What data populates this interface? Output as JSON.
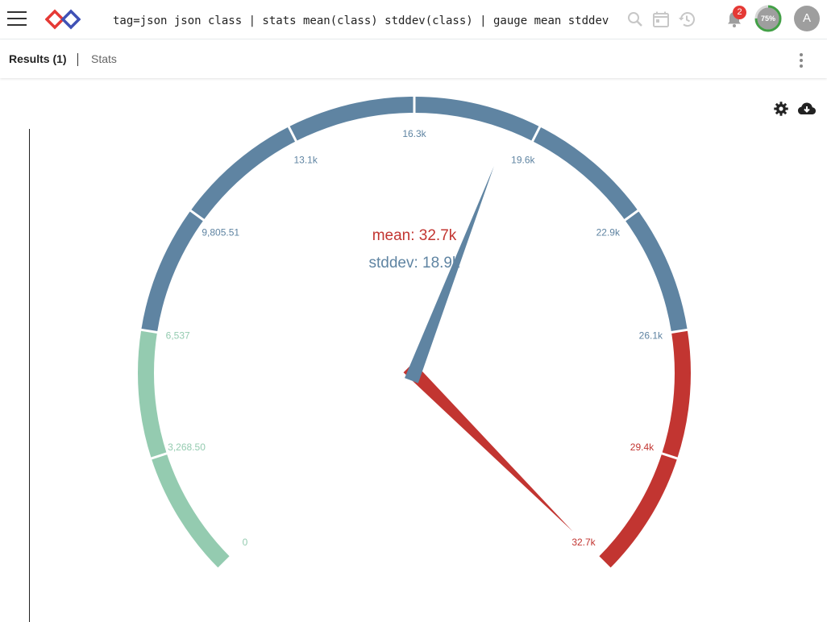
{
  "header": {
    "query": "tag=json json class | stats mean(class) stddev(class) | gauge mean stddev",
    "notification_count": "2",
    "progress_label": "75%",
    "progress_value": 0.75,
    "avatar_initial": "A"
  },
  "tabs": {
    "results_label": "Results (1)",
    "stats_label": "Stats"
  },
  "colors": {
    "green": "#94cbb0",
    "blue": "#5f84a2",
    "red": "#c23531",
    "progress": "#43a047"
  },
  "chart_data": {
    "type": "gauge",
    "min": 0,
    "max": 32700,
    "tick_labels": [
      "0",
      "3,268.50",
      "6,537",
      "9,805.51",
      "13.1k",
      "16.3k",
      "19.6k",
      "22.9k",
      "26.1k",
      "29.4k",
      "32.7k"
    ],
    "bands": [
      {
        "from": 0,
        "to": 0.2,
        "color": "#94cbb0"
      },
      {
        "from": 0.2,
        "to": 0.8,
        "color": "#5f84a2"
      },
      {
        "from": 0.8,
        "to": 1.0,
        "color": "#c23531"
      }
    ],
    "series": [
      {
        "name": "mean",
        "label": "mean: 32.7k",
        "value": 32700,
        "color": "#c23531"
      },
      {
        "name": "stddev",
        "label": "stddev: 18.9k",
        "value": 18900,
        "color": "#5f84a2"
      }
    ]
  }
}
